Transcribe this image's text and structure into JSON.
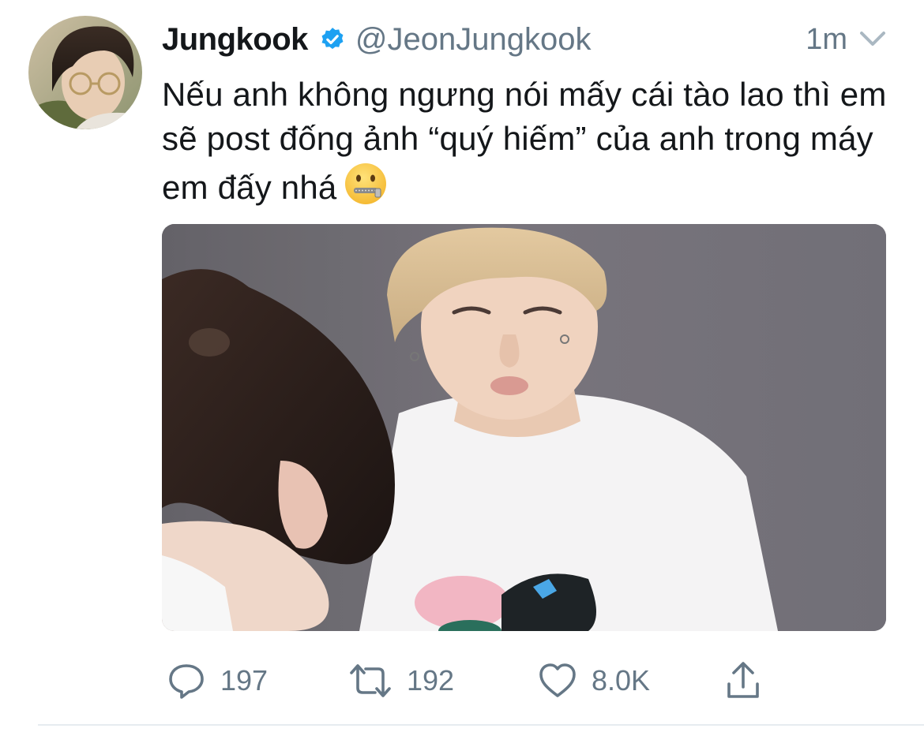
{
  "tweet": {
    "display_name": "Jungkook",
    "handle": "@JeonJungkook",
    "timestamp": "1m",
    "text": "Nếu anh không ngưng nói mấy cái tào lao thì em sẽ post đống ảnh “quý hiếm” của anh trong máy em đấy nhá",
    "emoji": "zipper-mouth-face-icon",
    "verified": true,
    "media": "photo-two-people-white-shirts"
  },
  "actions": {
    "reply_count": "197",
    "retweet_count": "192",
    "like_count": "8.0K"
  },
  "colors": {
    "text": "#14171a",
    "muted": "#657786",
    "verified_blue": "#1da1f2",
    "divider": "#e6ecf0"
  }
}
